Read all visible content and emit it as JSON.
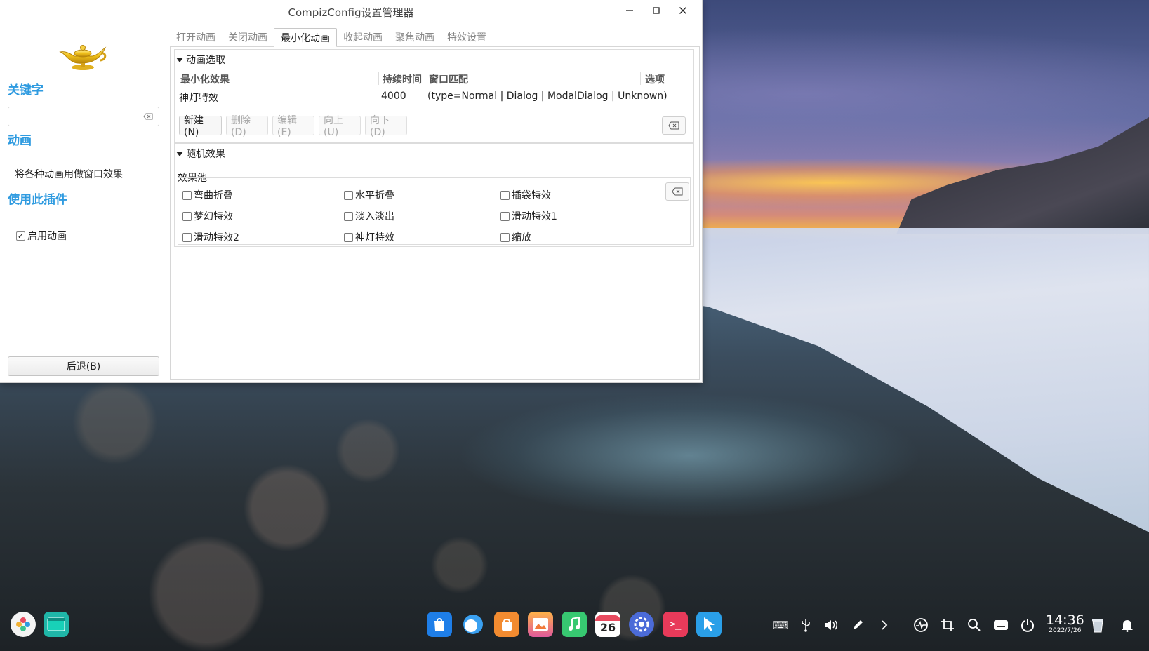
{
  "window": {
    "title": "CompizConfig设置管理器",
    "controls": {
      "minimize": "—",
      "maximize": "▢",
      "close": "✕"
    }
  },
  "sidebar": {
    "logo_icon": "genie-lamp-icon",
    "keyword_heading": "关键字",
    "search_value": "",
    "animation_heading": "动画",
    "description": "将各种动画用做窗口效果",
    "use_plugin_heading": "使用此插件",
    "enable_label": "启用动画",
    "enable_checked": true,
    "back_button": "后退(B)"
  },
  "tabs": [
    {
      "label": "打开动画",
      "active": false
    },
    {
      "label": "关闭动画",
      "active": false
    },
    {
      "label": "最小化动画",
      "active": true
    },
    {
      "label": "收起动画",
      "active": false
    },
    {
      "label": "聚焦动画",
      "active": false
    },
    {
      "label": "特效设置",
      "active": false
    }
  ],
  "selection_group": {
    "title": "动画选取",
    "columns": [
      "最小化效果",
      "持续时间",
      "窗口匹配",
      "选项"
    ],
    "rows": [
      {
        "effect": "神灯特效",
        "duration": "4000",
        "match": "(type=Normal | Dialog | ModalDialog | Unknown)",
        "options": ""
      }
    ],
    "buttons": {
      "new": "新建(N)",
      "delete": "删除(D)",
      "edit": "编辑(E)",
      "up": "向上(U)",
      "down": "向下(D)"
    }
  },
  "random_group": {
    "title": "随机效果",
    "pool_label": "效果池",
    "effects": [
      {
        "label": "弯曲折叠",
        "checked": false
      },
      {
        "label": "水平折叠",
        "checked": false
      },
      {
        "label": "插袋特效",
        "checked": false
      },
      {
        "label": "梦幻特效",
        "checked": false
      },
      {
        "label": "淡入淡出",
        "checked": false
      },
      {
        "label": "滑动特效1",
        "checked": false
      },
      {
        "label": "滑动特效2",
        "checked": false
      },
      {
        "label": "神灯特效",
        "checked": false
      },
      {
        "label": "缩放",
        "checked": false
      }
    ]
  },
  "taskbar": {
    "clock_time": "14:36",
    "clock_date": "2022/7/26",
    "calendar_day": "26",
    "colors": {
      "accent": "#2f9be0"
    }
  }
}
